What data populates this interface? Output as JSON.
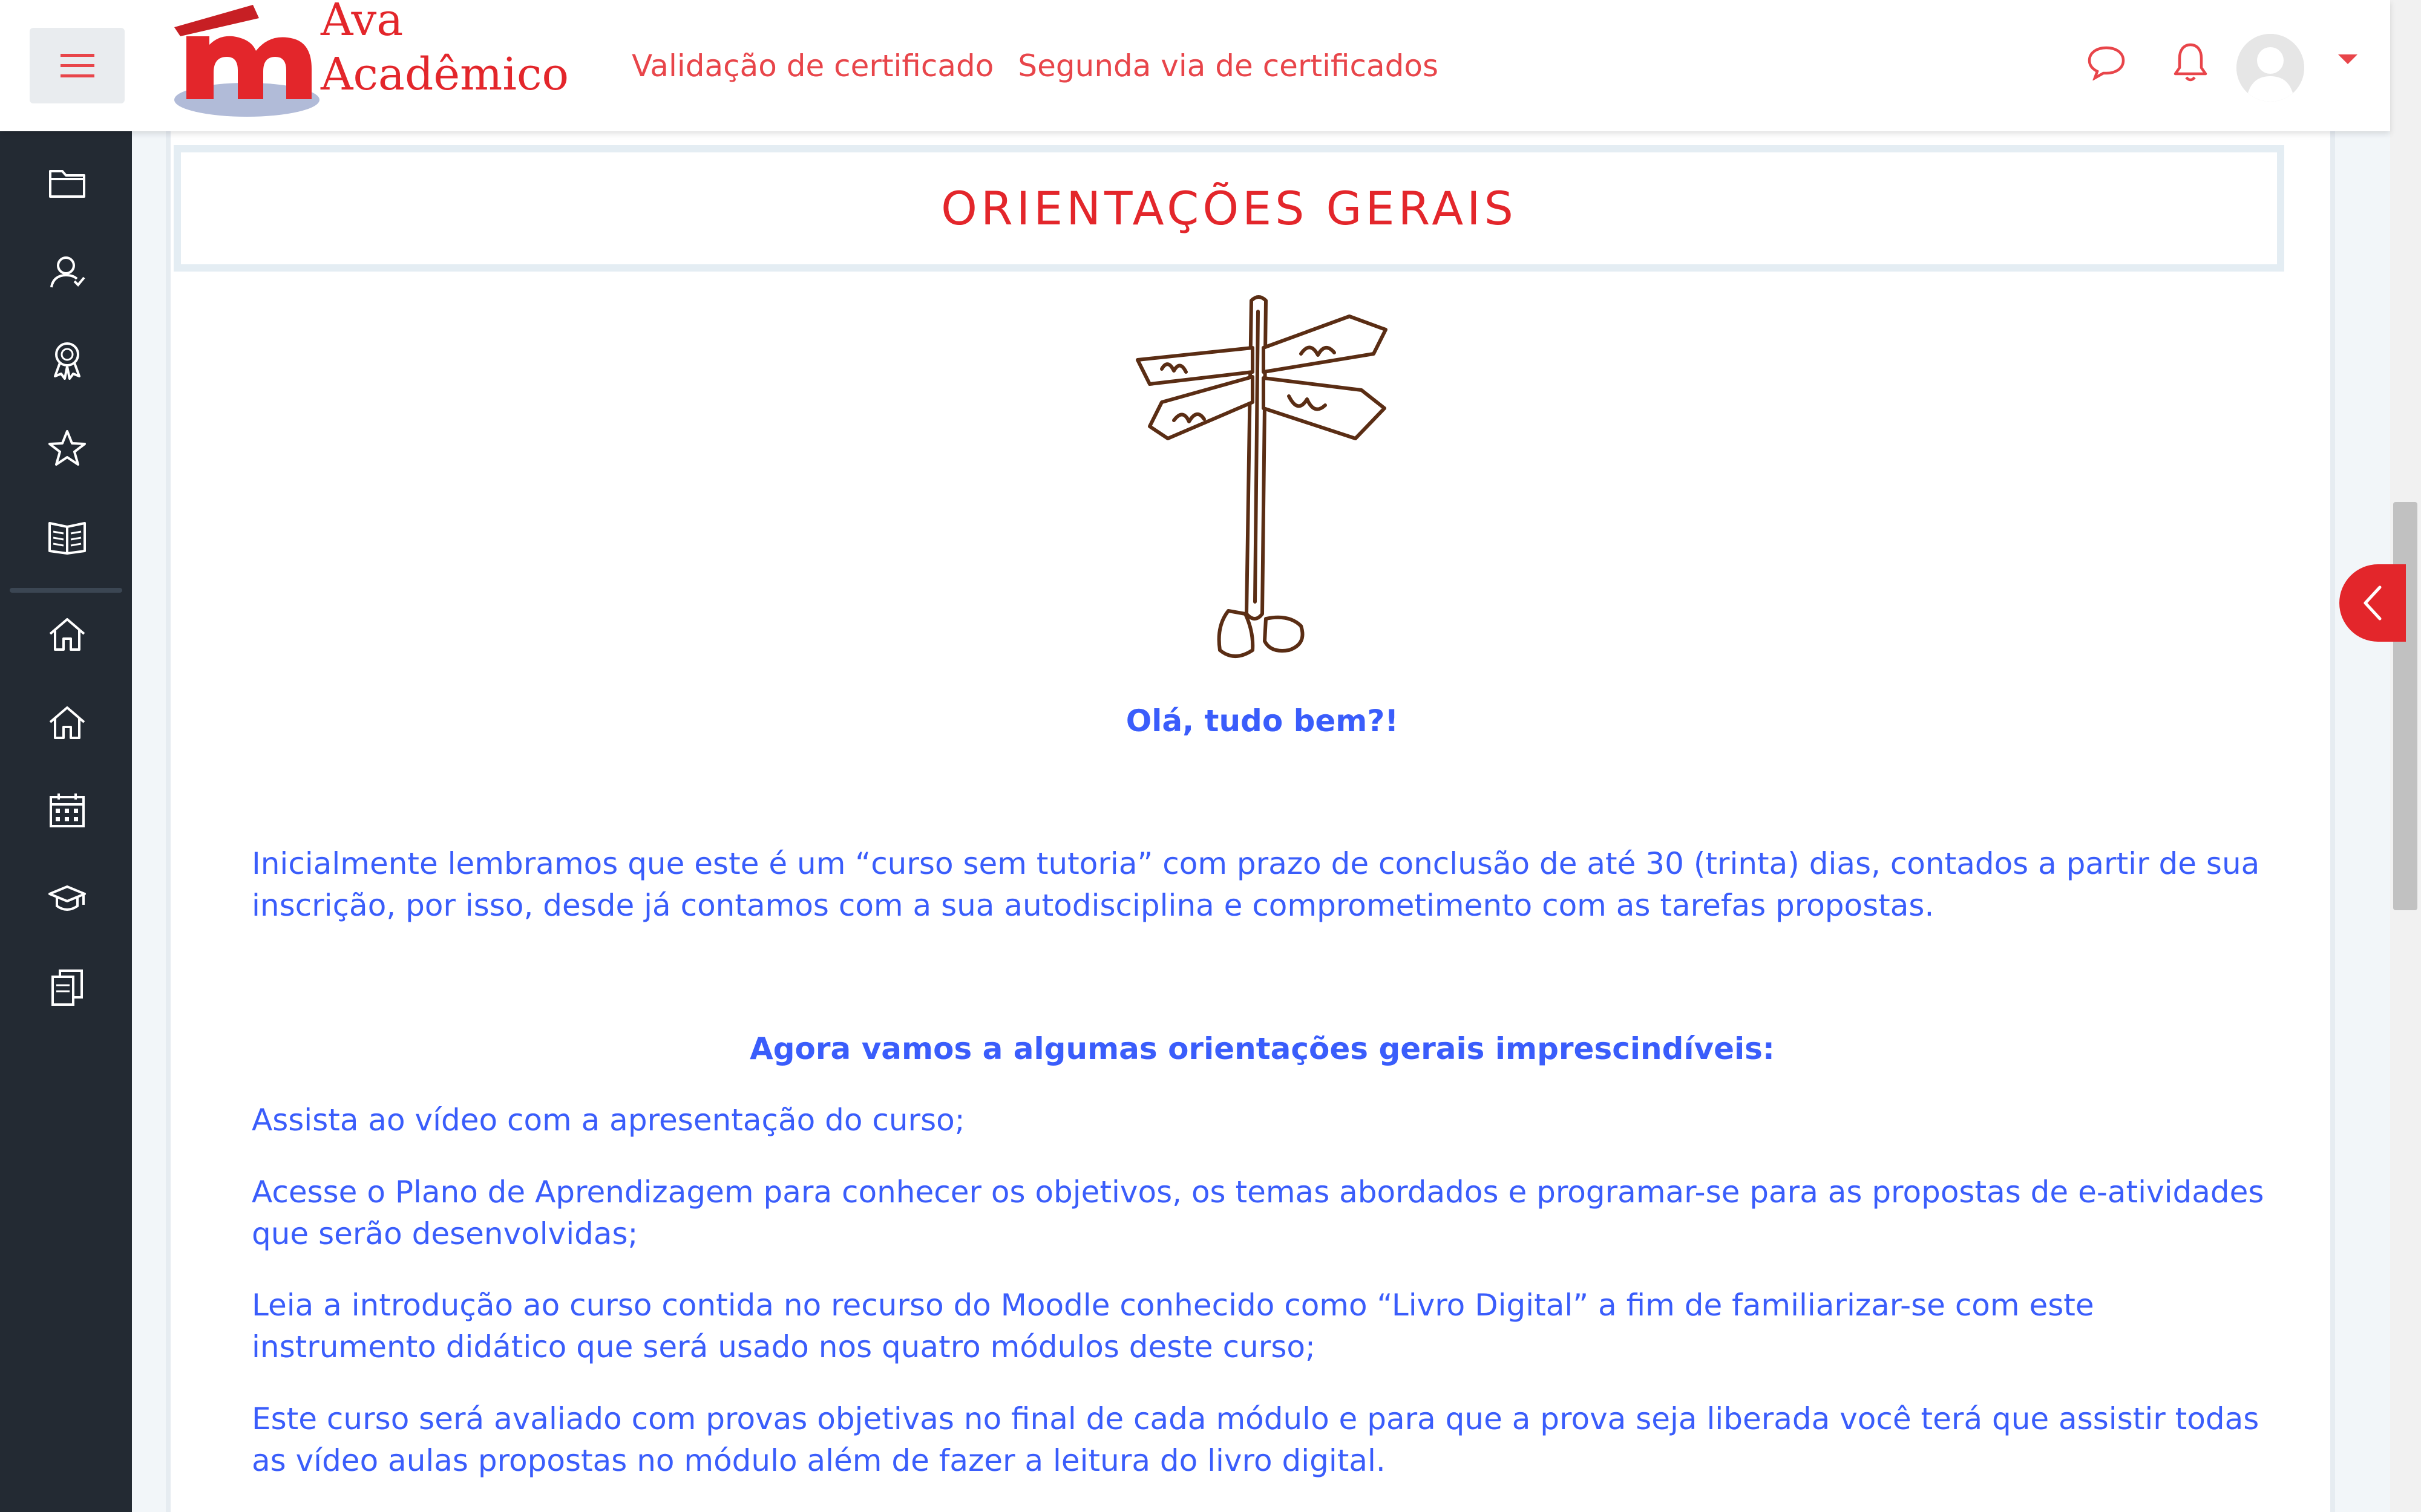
{
  "brand": {
    "logo_line1": "Ava",
    "logo_line2": "Acadêmico",
    "accent_color": "#e3262b",
    "text_blue": "#3a5dfb"
  },
  "navbar": {
    "menu_icon": "hamburger-icon",
    "links": [
      "Validação de certificado",
      "Segunda via de certificados"
    ],
    "icons": [
      "message-bubble-icon",
      "bell-icon",
      "user-avatar",
      "caret-down-icon"
    ]
  },
  "sidebar": {
    "items": [
      {
        "icon": "folder-icon"
      },
      {
        "icon": "user-badge-icon"
      },
      {
        "icon": "award-icon"
      },
      {
        "icon": "star-icon"
      },
      {
        "icon": "book-icon"
      },
      {
        "icon": "home-icon"
      },
      {
        "icon": "home-icon"
      },
      {
        "icon": "calendar-icon"
      },
      {
        "icon": "graduation-cap-icon"
      },
      {
        "icon": "files-icon"
      }
    ]
  },
  "main": {
    "title": "ORIENTAÇÕES GERAIS",
    "image_icon": "signpost-illustration",
    "greeting": "Olá, tudo bem?!",
    "paragraphs": {
      "intro": "Inicialmente lembramos que este é um “curso sem tutoria” com prazo de conclusão de até 30 (trinta) dias, contados a partir de sua inscrição, por isso, desde já contamos com a sua autodisciplina e comprometimento com as tarefas propostas.",
      "heading": "Agora vamos a algumas orientações gerais imprescindíveis:",
      "item1": "Assista ao vídeo com a apresentação do curso;",
      "item2": "Acesse o Plano de Aprendizagem para conhecer os objetivos, os temas abordados e  programar-se para as propostas de e-atividades que serão desenvolvidas;",
      "item3": "Leia a introdução ao curso contida no recurso do Moodle conhecido como “Livro Digital” a fim de familiarizar-se com este instrumento didático que será usado nos quatro módulos deste curso;",
      "item4": "Este curso será avaliado com provas objetivas no final de cada módulo e para que a prova seja liberada você terá que assistir todas as vídeo aulas propostas no módulo além de fazer a leitura do livro digital."
    }
  },
  "drawer_toggle_icon": "chevron-left-icon"
}
